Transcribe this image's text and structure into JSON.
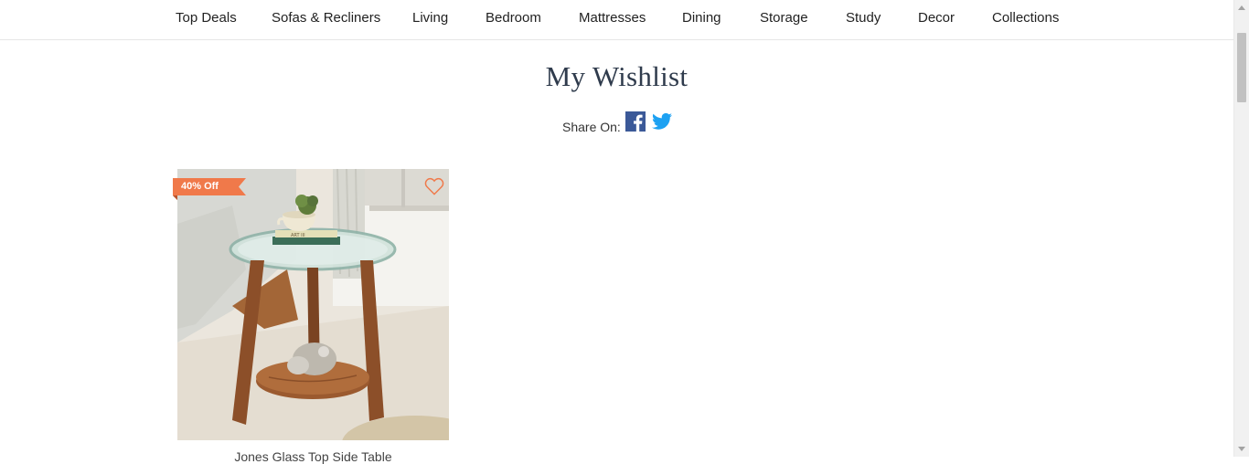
{
  "nav": {
    "items": [
      {
        "label": "Top Deals"
      },
      {
        "label": "Sofas & Recliners"
      },
      {
        "label": "Living"
      },
      {
        "label": "Bedroom"
      },
      {
        "label": "Mattresses"
      },
      {
        "label": "Dining"
      },
      {
        "label": "Storage"
      },
      {
        "label": "Study"
      },
      {
        "label": "Decor"
      },
      {
        "label": "Collections"
      }
    ]
  },
  "page": {
    "title": "My Wishlist",
    "share_label": "Share On:",
    "share_icons": [
      "facebook-icon",
      "twitter-icon"
    ]
  },
  "wishlist": {
    "items": [
      {
        "name": "Jones Glass Top Side Table",
        "badge": "40% Off",
        "badge_color": "#f0794a",
        "wishlist_icon": "heart-icon",
        "book_label": "ART III"
      }
    ]
  },
  "colors": {
    "facebook": "#3b5998",
    "twitter": "#1da1f2",
    "accent": "#f0794a",
    "title": "#2f3b4c"
  }
}
